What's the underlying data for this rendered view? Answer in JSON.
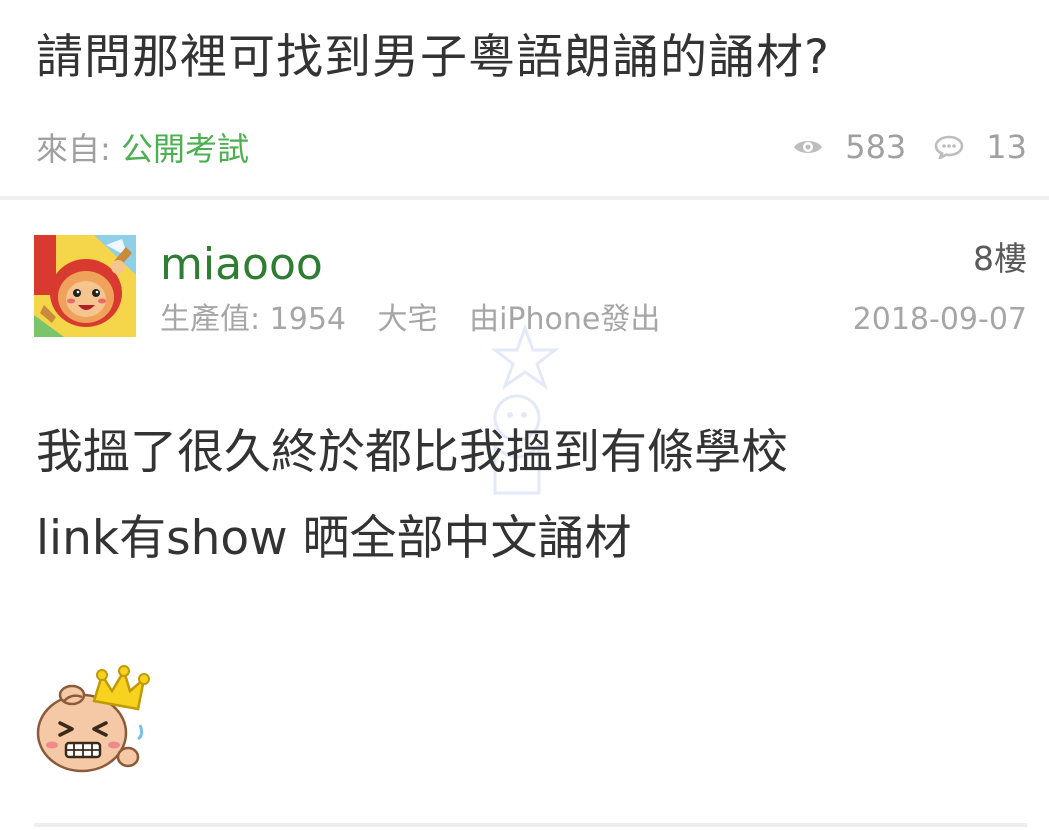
{
  "thread": {
    "title": "請問那裡可找到男子粵語朗誦的誦材?",
    "from_label": "來自:",
    "category": "公開考試",
    "views": "583",
    "replies": "13"
  },
  "post": {
    "username": "miaooo",
    "productivity_label": "生產值: 1954",
    "rank": "大宅",
    "device": "由iPhone發出",
    "floor": "8樓",
    "date": "2018-09-07",
    "body_lines": [
      "我搵了很久終於都比我搵到有條學校",
      "link有show 晒全部中文誦材"
    ]
  },
  "icons": {
    "views": "eye-icon",
    "replies": "comment-bubble-icon",
    "emoji": "laughing-baby-crown-emoji"
  },
  "colors": {
    "category": "#4caf50",
    "username": "#2e7d32",
    "muted": "#a0a0a0",
    "text": "#333333"
  }
}
